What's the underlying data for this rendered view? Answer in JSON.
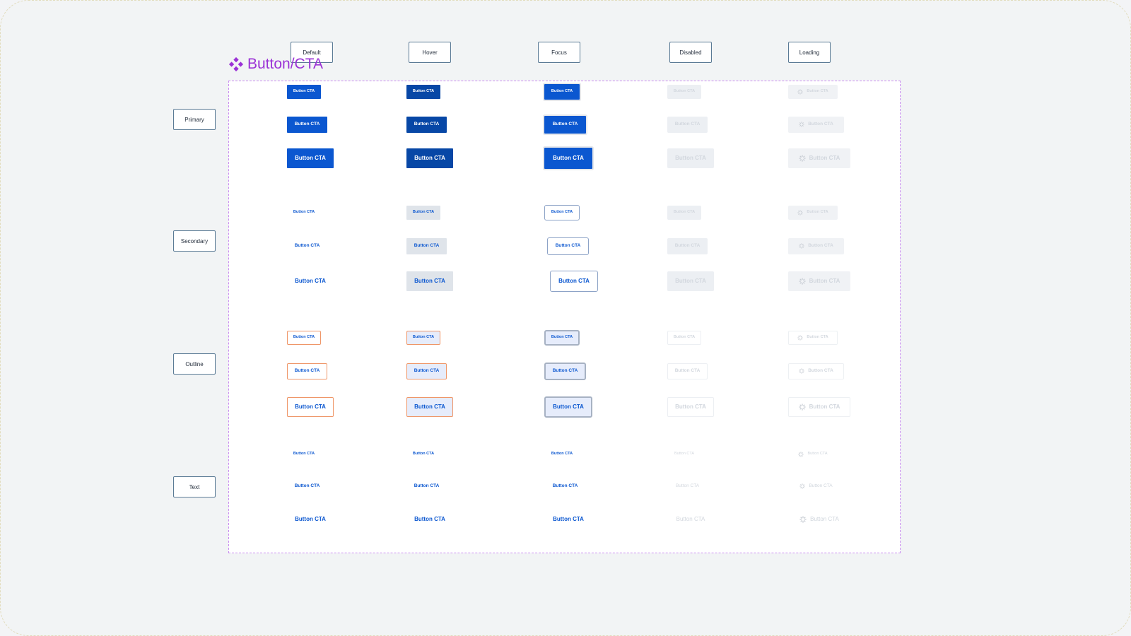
{
  "states": [
    "Default",
    "Hover",
    "Focus",
    "Disabled",
    "Loading"
  ],
  "variants": [
    "Primary",
    "Secondary",
    "Outline",
    "Text"
  ],
  "component": {
    "title": "Button/CTA",
    "icon": "component-diamond-icon"
  },
  "button_label": "Button CTA",
  "colors": {
    "brand_blue": "#0b57d0",
    "hover_blue": "#0747a6",
    "title_purple": "#9b32d6",
    "outline_orange": "#ef9668"
  }
}
